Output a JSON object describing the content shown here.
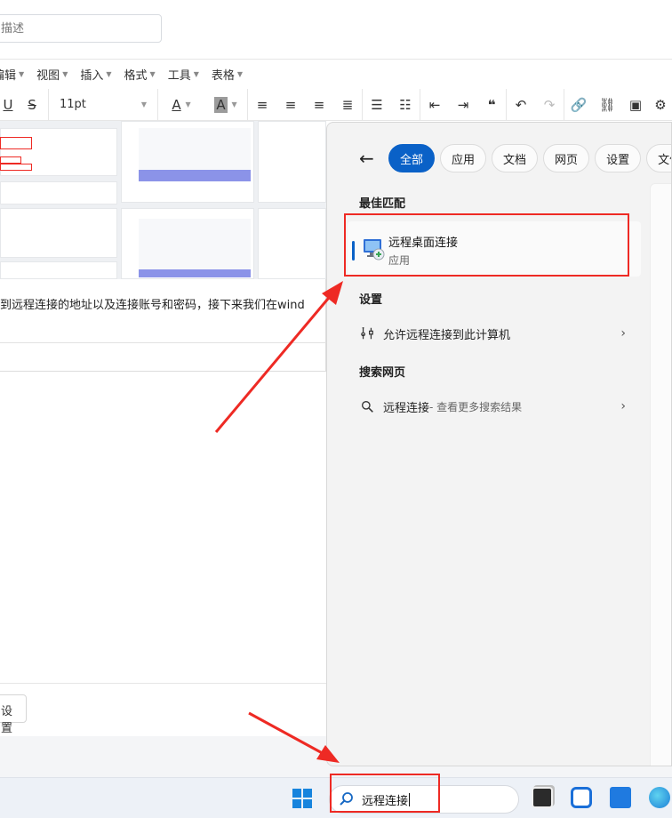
{
  "editor": {
    "desc_placeholder": "描述",
    "menus": [
      {
        "label": "编辑"
      },
      {
        "label": "视图"
      },
      {
        "label": "插入"
      },
      {
        "label": "格式"
      },
      {
        "label": "工具"
      },
      {
        "label": "表格"
      }
    ],
    "font_size": "11pt",
    "body_text": "到远程连接的地址以及连接账号和密码，接下来我们在wind",
    "footer_button": "设置"
  },
  "search_panel": {
    "filters": [
      "全部",
      "应用",
      "文档",
      "网页",
      "设置",
      "文件"
    ],
    "best_match_title": "最佳匹配",
    "best_match": {
      "name": "远程桌面连接",
      "type": "应用"
    },
    "settings_title": "设置",
    "settings_item": "允许远程连接到此计算机",
    "web_title": "搜索网页",
    "web_item": "远程连接",
    "web_item_hint": " - 查看更多搜索结果"
  },
  "taskbar": {
    "search_value": "远程连接"
  },
  "colors": {
    "accent": "#0a61c7",
    "annotation_red": "#ee2a24"
  }
}
